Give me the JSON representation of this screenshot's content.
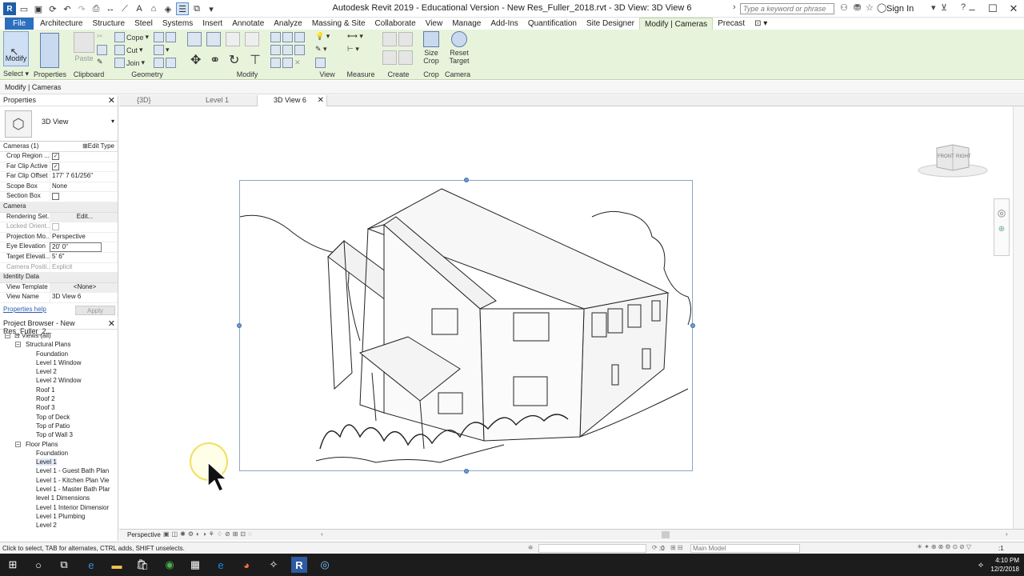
{
  "window": {
    "title": "Autodesk Revit 2019 - Educational Version - New Res_Fuller_2018.rvt - 3D View: 3D View 6",
    "search_placeholder": "Type a keyword or phrase",
    "sign_in": "Sign In"
  },
  "menu_tabs": [
    "File",
    "Architecture",
    "Structure",
    "Steel",
    "Systems",
    "Insert",
    "Annotate",
    "Analyze",
    "Massing & Site",
    "Collaborate",
    "View",
    "Manage",
    "Add-Ins",
    "Quantification",
    "Site Designer",
    "Modify | Cameras",
    "Precast"
  ],
  "ribbon": {
    "modify_label": "Modify",
    "select_label": "Select",
    "properties_label": "Properties",
    "paste_label": "Paste",
    "clipboard_label": "Clipboard",
    "cope_label": "Cope",
    "cut_label": "Cut",
    "join_label": "Join",
    "geometry_label": "Geometry",
    "modify_panel_label": "Modify",
    "view_label": "View",
    "measure_label": "Measure",
    "create_label": "Create",
    "size_crop_label": "Size Crop",
    "crop_label": "Crop",
    "reset_target_label": "Reset Target",
    "camera_label": "Camera"
  },
  "options_bar": "Modify | Cameras",
  "properties": {
    "title": "Properties",
    "type_name": "3D View",
    "filter": "Cameras (1)",
    "edit_type": "Edit Type",
    "rows1": [
      {
        "k": "Crop Region ...",
        "v": "checked"
      },
      {
        "k": "Far Clip Active",
        "v": "checked"
      },
      {
        "k": "Far Clip Offset",
        "v": "177'  7 61/256\""
      },
      {
        "k": "Scope Box",
        "v": "None"
      },
      {
        "k": "Section Box",
        "v": "unchecked"
      }
    ],
    "group_camera": "Camera",
    "rows2": [
      {
        "k": "Rendering Set...",
        "v": "Edit..."
      },
      {
        "k": "Locked Orient...",
        "v": ""
      },
      {
        "k": "Projection Mo...",
        "v": "Perspective"
      },
      {
        "k": "Eye Elevation",
        "v": "20'  0\""
      },
      {
        "k": "Target Elevati...",
        "v": "5'  6\""
      },
      {
        "k": "Camera Positi...",
        "v": "Explicit"
      }
    ],
    "group_identity": "Identity Data",
    "rows3": [
      {
        "k": "View Template",
        "v": "<None>"
      },
      {
        "k": "View Name",
        "v": "3D View 6"
      }
    ],
    "help": "Properties help",
    "apply": "Apply"
  },
  "project_browser": {
    "title": "Project Browser - New Res_Fuller_2...",
    "root": "Views (all)",
    "structural_plans": "Structural Plans",
    "structural_items": [
      "Foundation",
      "Level 1 Window",
      "Level 2",
      "Level 2 Window",
      "Roof 1",
      "Roof 2",
      "Roof 3",
      "Top of Deck",
      "Top of Patio",
      "Top of Wall 3"
    ],
    "floor_plans": "Floor Plans",
    "floor_items": [
      "Foundation",
      "Level 1",
      "Level 1 - Guest Bath Plan",
      "Level 1 - Kitchen Plan Vie",
      "Level 1 - Master Bath Plar",
      "level 1 Dimensions",
      "Level 1 Interior Dimensior",
      "Level 1 Plumbing",
      "Level 2"
    ]
  },
  "view_tabs": [
    "{3D}",
    "Level 1",
    "3D View 6"
  ],
  "viewcube": {
    "front": "FRONT",
    "right": "RIGHT"
  },
  "view_control": {
    "mode": "Perspective"
  },
  "status": {
    "message": "Click to select, TAB for alternates, CTRL adds, SHIFT unselects.",
    "zero": ":0",
    "model": "Main Model",
    "filter_count": ":1"
  },
  "taskbar": {
    "time": "4:10 PM",
    "date": "12/2/2018"
  }
}
